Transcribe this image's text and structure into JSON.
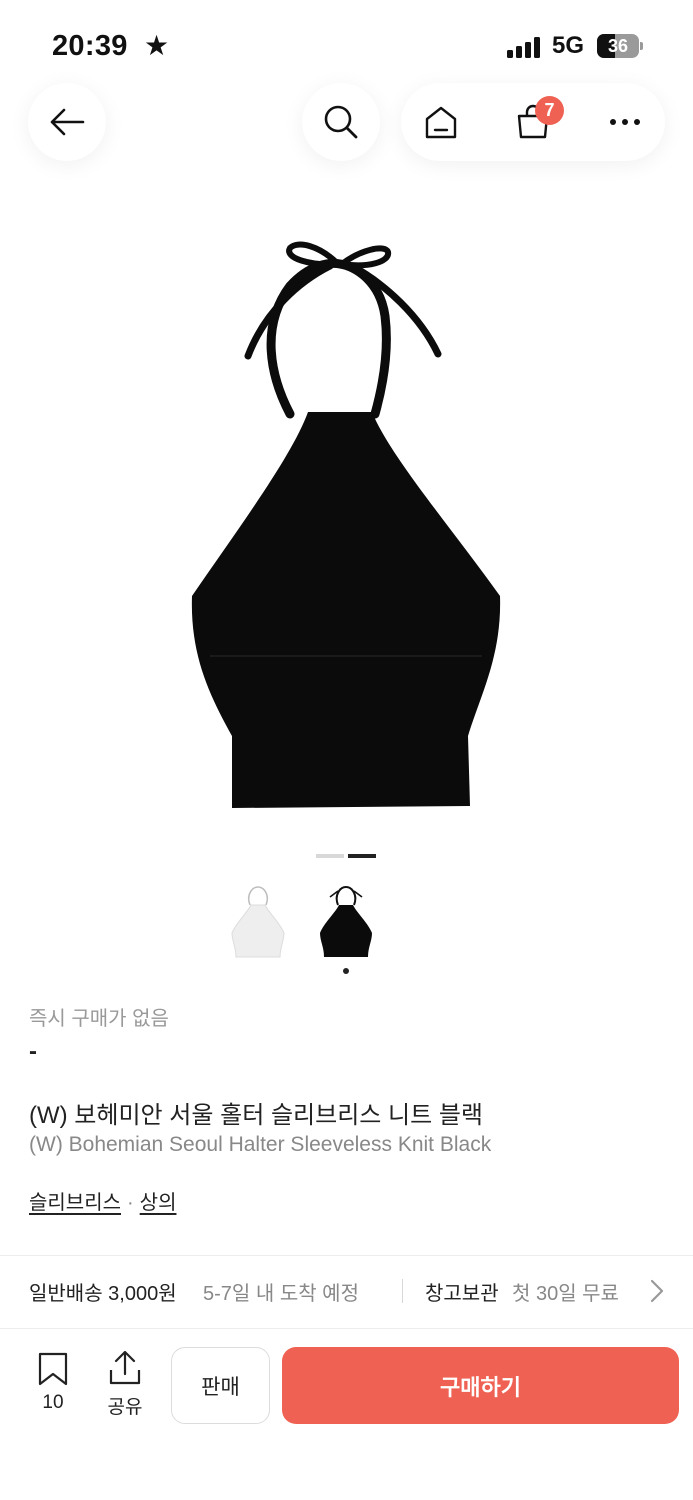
{
  "status_bar": {
    "time": "20:39",
    "network": "5G",
    "battery": "36"
  },
  "nav": {
    "cart_count": "7"
  },
  "gallery": {
    "pages": 2,
    "current_page": 2,
    "thumbnails": [
      "white",
      "black"
    ],
    "selected_thumbnail": 2
  },
  "product": {
    "price_label": "즉시 구매가 없음",
    "price_value": "-",
    "title_ko": "(W) 보헤미안 서울 홀터 슬리브리스 니트 블랙",
    "title_en": "(W) Bohemian Seoul Halter Sleeveless Knit Black",
    "categories": [
      "슬리브리스",
      "상의"
    ],
    "category_separator": "·"
  },
  "shipping": {
    "standard_label": "일반배송 3,000원",
    "standard_eta": "5-7일 내 도착 예정",
    "storage_label": "창고보관",
    "storage_offer": "첫 30일 무료"
  },
  "bottom_bar": {
    "bookmark_count": "10",
    "share_label": "공유",
    "sell_label": "판매",
    "buy_label": "구매하기"
  },
  "colors": {
    "accent": "#ef6253",
    "text": "#222222",
    "muted": "#888888"
  }
}
